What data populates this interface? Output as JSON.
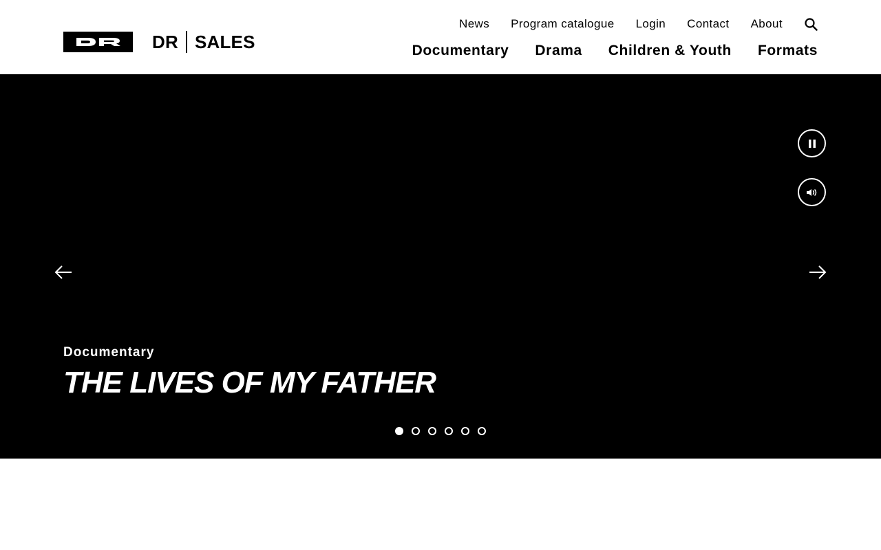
{
  "brand": {
    "logo_icon": "dr-logo-icon",
    "left": "DR",
    "right": "SALES"
  },
  "top_nav": [
    {
      "label": "News"
    },
    {
      "label": "Program catalogue"
    },
    {
      "label": "Login"
    },
    {
      "label": "Contact"
    },
    {
      "label": "About"
    }
  ],
  "search": {
    "icon": "search-icon"
  },
  "main_nav": [
    {
      "label": "Documentary"
    },
    {
      "label": "Drama"
    },
    {
      "label": "Children & Youth"
    },
    {
      "label": "Formats"
    }
  ],
  "hero": {
    "category": "Documentary",
    "title": "THE LIVES OF MY FATHER",
    "controls": {
      "pause_icon": "pause-icon",
      "sound_icon": "volume-icon"
    },
    "arrows": {
      "prev_icon": "arrow-left-icon",
      "next_icon": "arrow-right-icon"
    },
    "slides_total": 6,
    "active_slide": 1
  },
  "colors": {
    "hero_bg": "#000000",
    "page_bg": "#ffffff",
    "text": "#000000",
    "hero_text": "#ffffff"
  }
}
